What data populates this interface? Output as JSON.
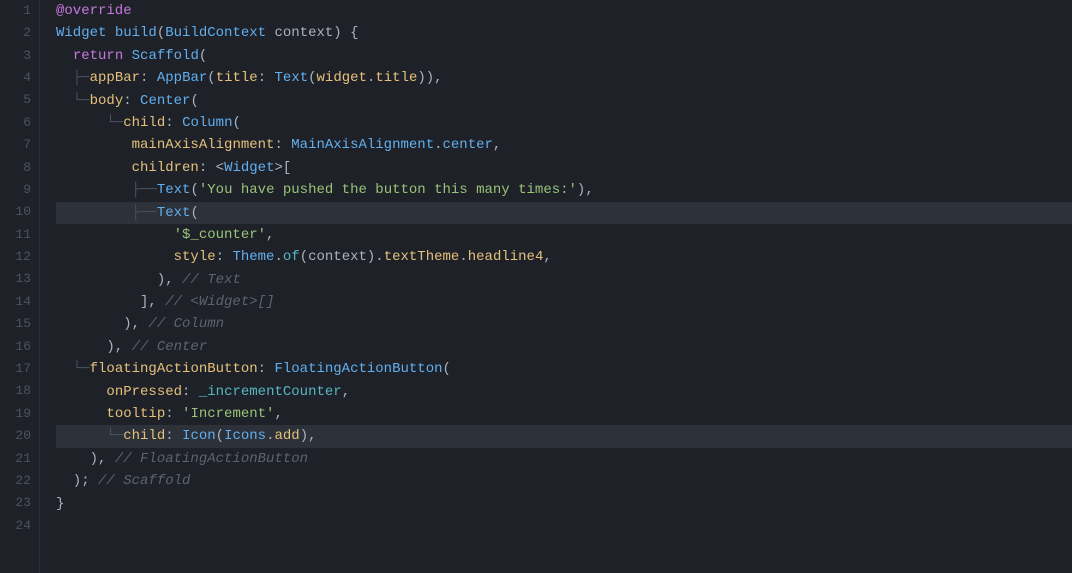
{
  "editor": {
    "background": "#1e2228",
    "lines": [
      {
        "number": 1,
        "active": false,
        "highlighted": false,
        "content": "@override"
      },
      {
        "number": 2,
        "active": false,
        "highlighted": false,
        "content": "Widget build(BuildContext context) {"
      },
      {
        "number": 3,
        "active": false,
        "highlighted": false,
        "content": "  return Scaffold("
      },
      {
        "number": 4,
        "active": false,
        "highlighted": false,
        "content": "    appBar: AppBar(title: Text(widget.title)),"
      },
      {
        "number": 5,
        "active": false,
        "highlighted": false,
        "content": "    body: Center("
      },
      {
        "number": 6,
        "active": false,
        "highlighted": false,
        "content": "      child: Column("
      },
      {
        "number": 7,
        "active": false,
        "highlighted": false,
        "content": "        mainAxisAlignment: MainAxisAlignment.center,"
      },
      {
        "number": 8,
        "active": false,
        "highlighted": false,
        "content": "        children: <Widget>["
      },
      {
        "number": 9,
        "active": false,
        "highlighted": false,
        "content": "          Text('You have pushed the button this many times:'),"
      },
      {
        "number": 10,
        "active": false,
        "highlighted": true,
        "content": "          Text("
      },
      {
        "number": 11,
        "active": false,
        "highlighted": false,
        "content": "            '$_counter',"
      },
      {
        "number": 12,
        "active": false,
        "highlighted": false,
        "content": "            style: Theme.of(context).textTheme.headline4,"
      },
      {
        "number": 13,
        "active": false,
        "highlighted": false,
        "content": "          ), // Text"
      },
      {
        "number": 14,
        "active": false,
        "highlighted": false,
        "content": "        ], // <Widget>[]"
      },
      {
        "number": 15,
        "active": false,
        "highlighted": false,
        "content": "      ), // Column"
      },
      {
        "number": 16,
        "active": false,
        "highlighted": false,
        "content": "    ), // Center"
      },
      {
        "number": 17,
        "active": false,
        "highlighted": false,
        "content": "    floatingActionButton: FloatingActionButton("
      },
      {
        "number": 18,
        "active": false,
        "highlighted": false,
        "content": "      onPressed: _incrementCounter,"
      },
      {
        "number": 19,
        "active": false,
        "highlighted": false,
        "content": "      tooltip: 'Increment',"
      },
      {
        "number": 20,
        "active": false,
        "highlighted": true,
        "content": "      child: Icon(Icons.add),"
      },
      {
        "number": 21,
        "active": false,
        "highlighted": false,
        "content": "    ), // FloatingActionButton"
      },
      {
        "number": 22,
        "active": false,
        "highlighted": false,
        "content": "  ); // Scaffold"
      },
      {
        "number": 23,
        "active": false,
        "highlighted": false,
        "content": "}"
      }
    ]
  }
}
